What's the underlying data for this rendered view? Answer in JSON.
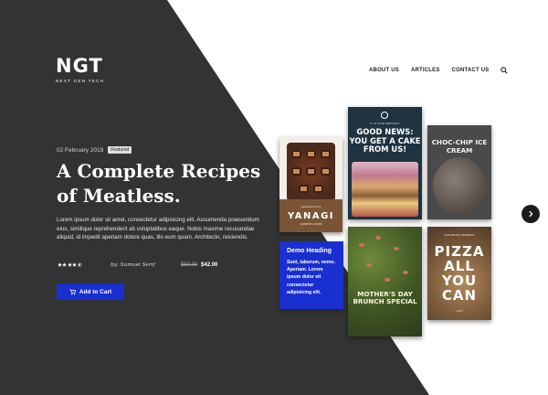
{
  "brand": {
    "logo_mark": "NGT",
    "logo_sub": "NEXT GEN TECH"
  },
  "nav": {
    "items": [
      "ABOUT US",
      "ARTICLES",
      "CONTACT US"
    ],
    "search_icon": "search-icon"
  },
  "hero": {
    "date": "02 February 2019",
    "badge": "Featured",
    "title": "A Complete Recipes of Meatless.",
    "description": "Lorem ipsum dolor sit amet, consectetur adipisicing elit. Assumenda praesentium eius, similique reprehenderit ab voluptatibus eaque. Nobis maxime recusandae aliquid, id impedit aperiam dolore quas, illo eum quam. Architecto, reiciendis.",
    "rating": 4.5,
    "rating_max": 5,
    "author": "by: Samuel Serif",
    "old_price": "$50.00",
    "new_price": "$42.00",
    "cart_button": "Add to Cart"
  },
  "books": {
    "yanagi": {
      "kicker": "Japanese Food",
      "title": "YANAGI",
      "sub": "JAPANESE CUISINE"
    },
    "goodnews": {
      "kicker": "IT IS YOUR BIRTHDAY!",
      "title": "GOOD NEWS: YOU GET A CAKE FROM US!"
    },
    "choc": {
      "title": "CHOC-CHIP ICE CREAM"
    },
    "mothers": {
      "title": "MOTHER'S DAY BRUNCH SPECIAL"
    },
    "pizza": {
      "kicker": "SOLOMON'S PIZZERIA",
      "title": "PIZZA ALL YOU CAN",
      "foot": "LATE"
    }
  },
  "demo_card": {
    "heading": "Demo Heading",
    "text": "Sunt, laborum, nemo. Aperiam. Lorem ipsum dolor sit consectetur adipisicing elit."
  },
  "colors": {
    "dark": "#333333",
    "accent": "#1a2fd0",
    "text_light": "#ffffff"
  }
}
